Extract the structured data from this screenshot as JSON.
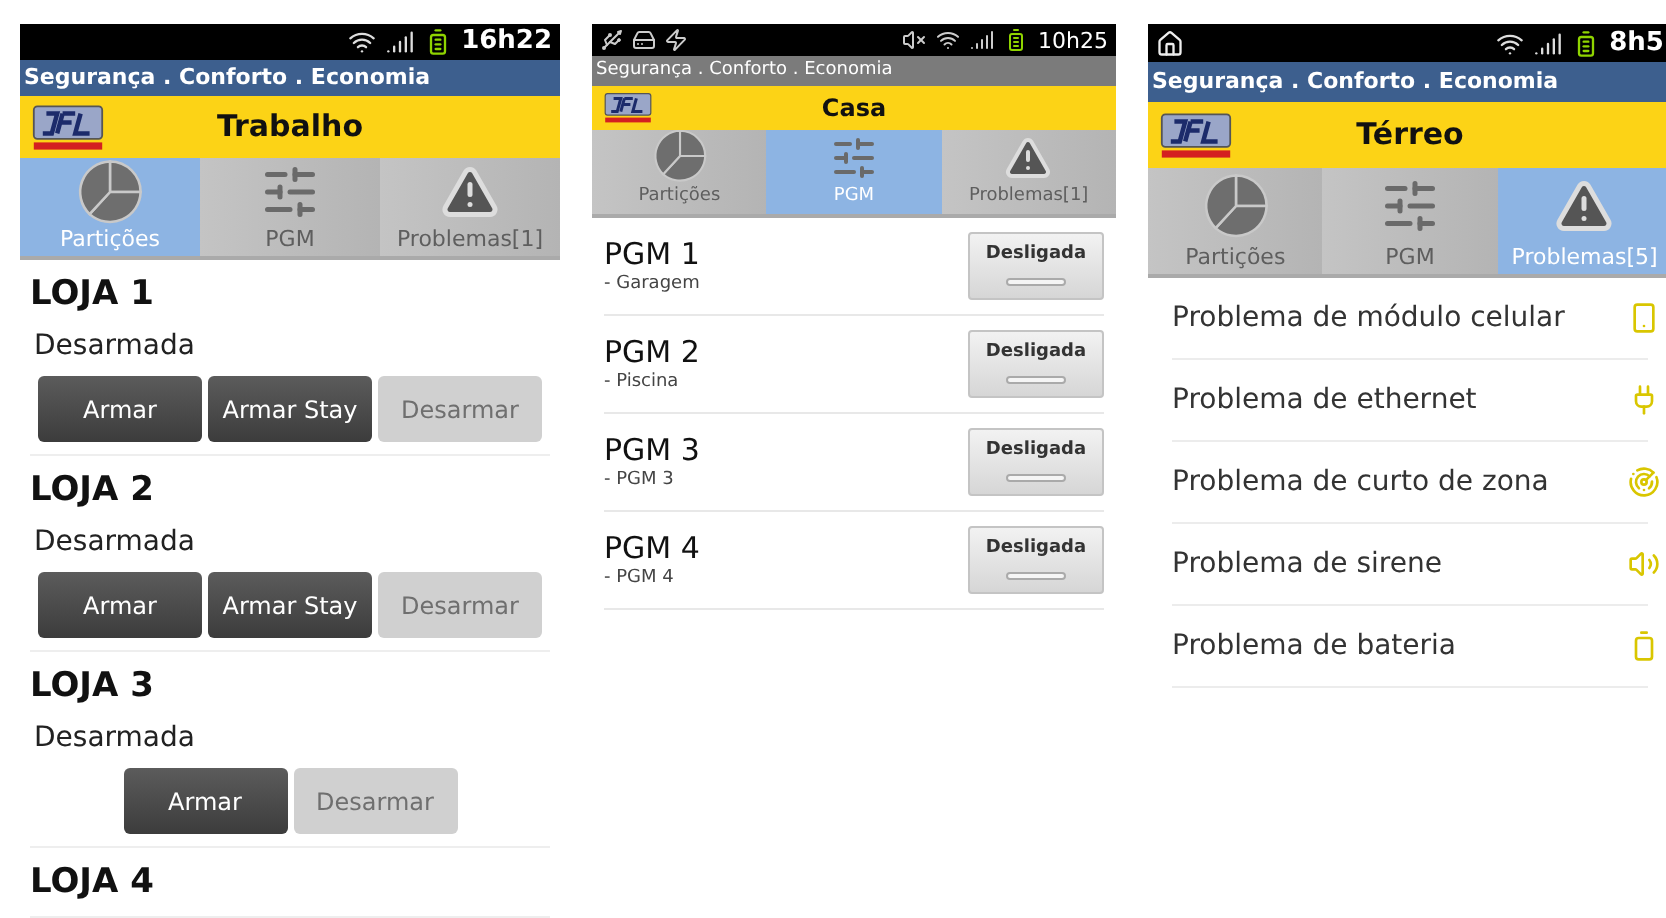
{
  "phones": [
    {
      "status_bar": {
        "time": "16h22"
      },
      "tagline": {
        "text": "Segurança . Conforto . Economia",
        "color": "#3d5f8e"
      },
      "title": "Trabalho",
      "tabs": [
        {
          "label": "Partições",
          "selected": true
        },
        {
          "label": "PGM",
          "selected": false
        },
        {
          "label": "Problemas[1]",
          "selected": false
        }
      ],
      "kind": "partitions",
      "partitions": [
        {
          "name": "LOJA 1",
          "status": "Desarmada",
          "buttons": [
            {
              "label": "Armar",
              "disabled": false
            },
            {
              "label": "Armar Stay",
              "disabled": false
            },
            {
              "label": "Desarmar",
              "disabled": true
            }
          ]
        },
        {
          "name": "LOJA 2",
          "status": "Desarmada",
          "buttons": [
            {
              "label": "Armar",
              "disabled": false
            },
            {
              "label": "Armar Stay",
              "disabled": false
            },
            {
              "label": "Desarmar",
              "disabled": true
            }
          ]
        },
        {
          "name": "LOJA 3",
          "status": "Desarmada",
          "buttons": [
            {
              "label": "Armar",
              "disabled": false
            },
            {
              "label": "Desarmar",
              "disabled": true
            }
          ]
        },
        {
          "name": "LOJA 4"
        }
      ]
    },
    {
      "status_bar": {
        "time": "10h25"
      },
      "tagline": {
        "text": "Segurança . Conforto . Economia",
        "color": "#7b7b7b"
      },
      "title": "Casa",
      "tabs": [
        {
          "label": "Partições",
          "selected": false
        },
        {
          "label": "PGM",
          "selected": true
        },
        {
          "label": "Problemas[1]",
          "selected": false
        }
      ],
      "kind": "pgm",
      "pgms": [
        {
          "name": "PGM 1",
          "detail": "- Garagem",
          "state": "Desligada",
          "on": false
        },
        {
          "name": "PGM 2",
          "detail": "- Piscina",
          "state": "Desligada",
          "on": false
        },
        {
          "name": "PGM 3",
          "detail": "- PGM 3",
          "state": "Desligada",
          "on": false
        },
        {
          "name": "PGM 4",
          "detail": "- PGM 4",
          "state": "Desligada",
          "on": false
        }
      ]
    },
    {
      "status_bar": {
        "time": "8h5"
      },
      "tagline": {
        "text": "Segurança . Conforto . Economia",
        "color": "#3d5f8e"
      },
      "title": "Térreo",
      "tabs": [
        {
          "label": "Partições",
          "selected": false
        },
        {
          "label": "PGM",
          "selected": false
        },
        {
          "label": "Problemas[5]",
          "selected": true
        }
      ],
      "kind": "problems",
      "problems": [
        "Problema de módulo celular",
        "Problema de ethernet",
        "Problema de curto de zona",
        "Problema de sirene",
        "Problema de bateria"
      ]
    }
  ]
}
